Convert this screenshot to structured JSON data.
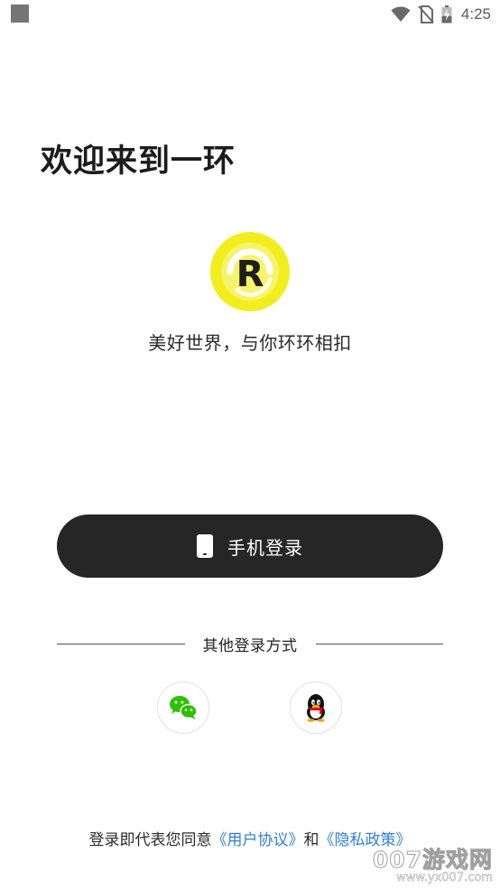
{
  "status_bar": {
    "time": "4:25",
    "icons": [
      "notification-square-icon",
      "wifi-icon",
      "no-sim-icon",
      "battery-charging-icon"
    ]
  },
  "welcome": {
    "title": "欢迎来到一环",
    "slogan": "美好世界，与你环环相扣"
  },
  "logo": {
    "letter": "R",
    "colors": {
      "outer": "#f2ee1e",
      "ring": "#ffffff",
      "letter": "#1e1e1e"
    }
  },
  "login": {
    "phone_button_label": "手机登录",
    "phone_button_color": "#262626",
    "other_methods_label": "其他登录方式",
    "methods": [
      {
        "name": "wechat",
        "icon": "wechat-icon",
        "color": "#2dc100"
      },
      {
        "name": "qq",
        "icon": "qq-penguin-icon",
        "color": "#000000"
      }
    ]
  },
  "agreement": {
    "prefix": "登录即代表您同意",
    "user_agreement": "《用户协议》",
    "conjunction": "和",
    "privacy_policy": "《隐私政策》",
    "link_color": "#2f7fd6"
  },
  "watermark": {
    "main": "007游戏网",
    "sub": "www.yx007.com"
  }
}
